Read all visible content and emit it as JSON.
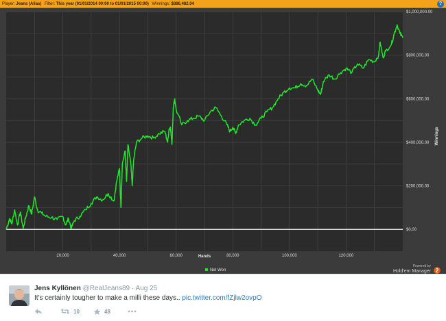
{
  "filter_bar": {
    "player_label": "Player:",
    "player_value": "Jeans (Alias)",
    "filter_label": "Filter:",
    "filter_value": "This year (01/01/2014 00:00 to 01/01/2015 00:00)",
    "winnings_label": "Winnings:",
    "winnings_value": "$886,482.04",
    "help_glyph": "?"
  },
  "chart_data": {
    "type": "line",
    "xlabel": "Hands",
    "ylabel": "Winnings",
    "xlim": [
      0,
      140000
    ],
    "ylim": [
      -100000,
      1000000
    ],
    "x_ticks": [
      20000,
      40000,
      60000,
      80000,
      100000,
      120000
    ],
    "x_tick_labels": [
      "20,000",
      "40,000",
      "60,000",
      "80,000",
      "100,000",
      "120,000"
    ],
    "y_ticks": [
      0,
      200000,
      400000,
      600000,
      800000,
      1000000
    ],
    "y_tick_labels": [
      "$0.00",
      "$200,000.00",
      "$400,000.00",
      "$600,000.00",
      "$800,000.00",
      "$1,000,000.00"
    ],
    "grid": true,
    "legend": "bottom-center",
    "series": [
      {
        "name": "Net Won",
        "color": "#22e82b",
        "points": [
          [
            0,
            0
          ],
          [
            1200,
            50000
          ],
          [
            2000,
            25000
          ],
          [
            3000,
            90000
          ],
          [
            4000,
            20000
          ],
          [
            5000,
            80000
          ],
          [
            6000,
            5000
          ],
          [
            7000,
            60000
          ],
          [
            8000,
            110000
          ],
          [
            9000,
            70000
          ],
          [
            10000,
            150000
          ],
          [
            11000,
            90000
          ],
          [
            12500,
            75000
          ],
          [
            14000,
            60000
          ],
          [
            16000,
            55000
          ],
          [
            18000,
            45000
          ],
          [
            20000,
            60000
          ],
          [
            21000,
            20000
          ],
          [
            22000,
            50000
          ],
          [
            23000,
            5000
          ],
          [
            24000,
            40000
          ],
          [
            26000,
            60000
          ],
          [
            28000,
            90000
          ],
          [
            30000,
            120000
          ],
          [
            32000,
            150000
          ],
          [
            34000,
            135000
          ],
          [
            36000,
            165000
          ],
          [
            38000,
            130000
          ],
          [
            39000,
            220000
          ],
          [
            40000,
            280000
          ],
          [
            40500,
            100000
          ],
          [
            41000,
            300000
          ],
          [
            42000,
            360000
          ],
          [
            42500,
            220000
          ],
          [
            43000,
            390000
          ],
          [
            44000,
            300000
          ],
          [
            44500,
            200000
          ],
          [
            45000,
            320000
          ],
          [
            46000,
            400000
          ],
          [
            48000,
            420000
          ],
          [
            50000,
            430000
          ],
          [
            52000,
            420000
          ],
          [
            54000,
            440000
          ],
          [
            56000,
            450000
          ],
          [
            57000,
            400000
          ],
          [
            57500,
            460000
          ],
          [
            58000,
            470000
          ],
          [
            58500,
            390000
          ],
          [
            59000,
            560000
          ],
          [
            59500,
            600000
          ],
          [
            60000,
            550000
          ],
          [
            62000,
            480000
          ],
          [
            64000,
            500000
          ],
          [
            66000,
            510000
          ],
          [
            68000,
            520000
          ],
          [
            70000,
            500000
          ],
          [
            72000,
            540000
          ],
          [
            74000,
            560000
          ],
          [
            76000,
            520000
          ],
          [
            78000,
            480000
          ],
          [
            79000,
            450000
          ],
          [
            80000,
            470000
          ],
          [
            81000,
            440000
          ],
          [
            82000,
            480000
          ],
          [
            84000,
            500000
          ],
          [
            86000,
            510000
          ],
          [
            88000,
            480000
          ],
          [
            90000,
            510000
          ],
          [
            92000,
            540000
          ],
          [
            94000,
            560000
          ],
          [
            96000,
            600000
          ],
          [
            98000,
            630000
          ],
          [
            100000,
            650000
          ],
          [
            102000,
            650000
          ],
          [
            104000,
            670000
          ],
          [
            106000,
            660000
          ],
          [
            108000,
            690000
          ],
          [
            110000,
            640000
          ],
          [
            111000,
            620000
          ],
          [
            112000,
            680000
          ],
          [
            114000,
            710000
          ],
          [
            116000,
            690000
          ],
          [
            118000,
            720000
          ],
          [
            120000,
            740000
          ],
          [
            122000,
            720000
          ],
          [
            124000,
            760000
          ],
          [
            126000,
            740000
          ],
          [
            128000,
            780000
          ],
          [
            130000,
            770000
          ],
          [
            131500,
            800000
          ],
          [
            132000,
            860000
          ],
          [
            133000,
            790000
          ],
          [
            134000,
            820000
          ],
          [
            136000,
            850000
          ],
          [
            137000,
            900000
          ],
          [
            138000,
            940000
          ],
          [
            139000,
            900000
          ],
          [
            140000,
            880000
          ]
        ]
      }
    ]
  },
  "branding": {
    "powered_by": "Powered by",
    "product": "Hold'em Manager",
    "version": "2"
  },
  "tweet": {
    "name": "Jens Kyllönen",
    "handle": "@RealJeans89",
    "separator": "·",
    "date": "Aug 25",
    "text": "It's certainly tougher to make a milli these days..",
    "link": "pic.twitter.com/fZjlw2ovpO",
    "retweet_count": "10",
    "favorite_count": "48"
  },
  "icons": {
    "reply": "reply-icon",
    "retweet": "retweet-icon",
    "favorite": "star-icon",
    "more": "more-icon"
  }
}
